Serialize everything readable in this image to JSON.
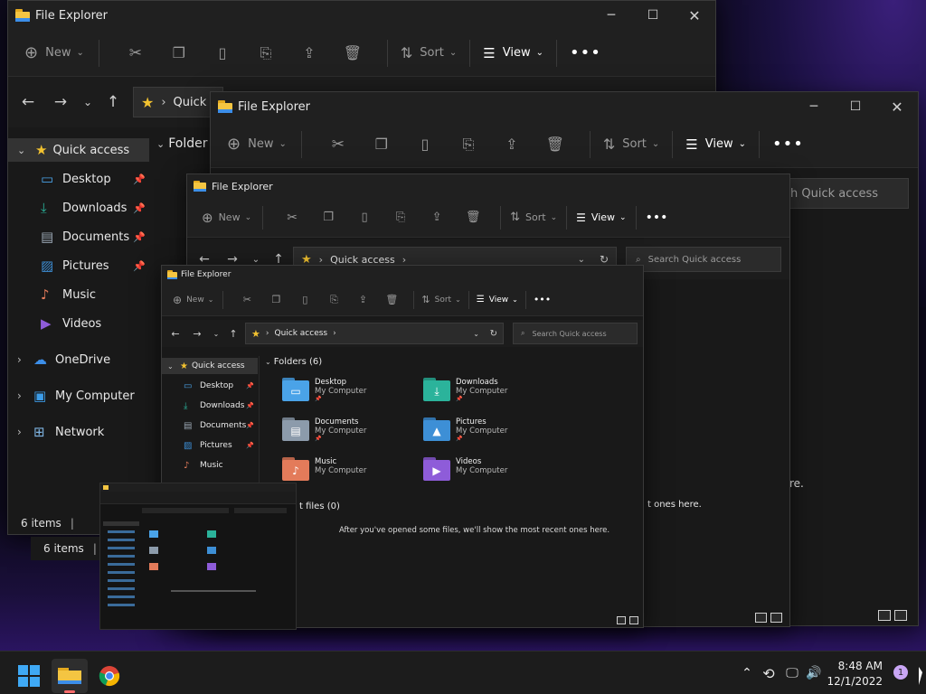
{
  "theme": {
    "accent": "#60cdff",
    "folder_yellow": "#f4c542",
    "window_bg": "#191919",
    "title_bg": "#202020",
    "taskbar_bg": "#1c1c1c"
  },
  "window_a": {
    "title": "File Explorer",
    "toolbar": {
      "new": "New",
      "sort": "Sort",
      "view": "View"
    },
    "address": "Quick a",
    "nav_header": "Quick access",
    "sidebar": [
      {
        "label": "Desktop",
        "icon": "desktop-icon"
      },
      {
        "label": "Downloads",
        "icon": "download-icon"
      },
      {
        "label": "Documents",
        "icon": "document-icon"
      },
      {
        "label": "Pictures",
        "icon": "picture-icon"
      },
      {
        "label": "Music",
        "icon": "music-icon"
      },
      {
        "label": "Videos",
        "icon": "video-icon"
      }
    ],
    "sidebar_roots": [
      {
        "label": "OneDrive",
        "icon": "cloud-icon"
      },
      {
        "label": "My Computer",
        "icon": "computer-icon"
      },
      {
        "label": "Network",
        "icon": "network-icon"
      }
    ],
    "content_header": "Folder",
    "status": "6 items"
  },
  "window_b": {
    "title": "File Explorer",
    "toolbar": {
      "new": "New",
      "sort": "Sort",
      "view": "View"
    },
    "search_placeholder": "h Quick access",
    "recent_tail": "re.",
    "status": "6 items"
  },
  "window_c": {
    "title": "File Explorer",
    "toolbar": {
      "new": "New",
      "sort": "Sort",
      "view": "View"
    },
    "address": "Quick access",
    "search_placeholder": "Search Quick access",
    "recent_tail": "t ones here."
  },
  "window_d": {
    "title": "File Explorer",
    "toolbar": {
      "new": "New",
      "sort": "Sort",
      "view": "View"
    },
    "address": "Quick access",
    "search_placeholder": "Search Quick access",
    "nav_header": "Quick access",
    "sidebar": [
      {
        "label": "Desktop",
        "icon": "desktop-icon",
        "pinned": true
      },
      {
        "label": "Downloads",
        "icon": "download-icon",
        "pinned": true
      },
      {
        "label": "Documents",
        "icon": "document-icon",
        "pinned": true
      },
      {
        "label": "Pictures",
        "icon": "picture-icon",
        "pinned": true
      },
      {
        "label": "Music",
        "icon": "music-icon",
        "pinned": false
      }
    ],
    "folders_header": "Folders (6)",
    "folders": [
      {
        "name": "Desktop",
        "location": "My Computer",
        "color": "#4aa3e8"
      },
      {
        "name": "Downloads",
        "location": "My Computer",
        "color": "#2bb39b"
      },
      {
        "name": "Documents",
        "location": "My Computer",
        "color": "#8c9bab"
      },
      {
        "name": "Pictures",
        "location": "My Computer",
        "color": "#3d8fd6"
      },
      {
        "name": "Music",
        "location": "My Computer",
        "color": "#e37b5a"
      },
      {
        "name": "Videos",
        "location": "My Computer",
        "color": "#8e5cd9"
      }
    ],
    "recent_header": "t files (0)",
    "recent_empty": "After you've opened some files, we'll show the most recent ones here."
  },
  "taskbar": {
    "time": "8:48 AM",
    "date": "12/1/2022",
    "notification_count": "1"
  }
}
